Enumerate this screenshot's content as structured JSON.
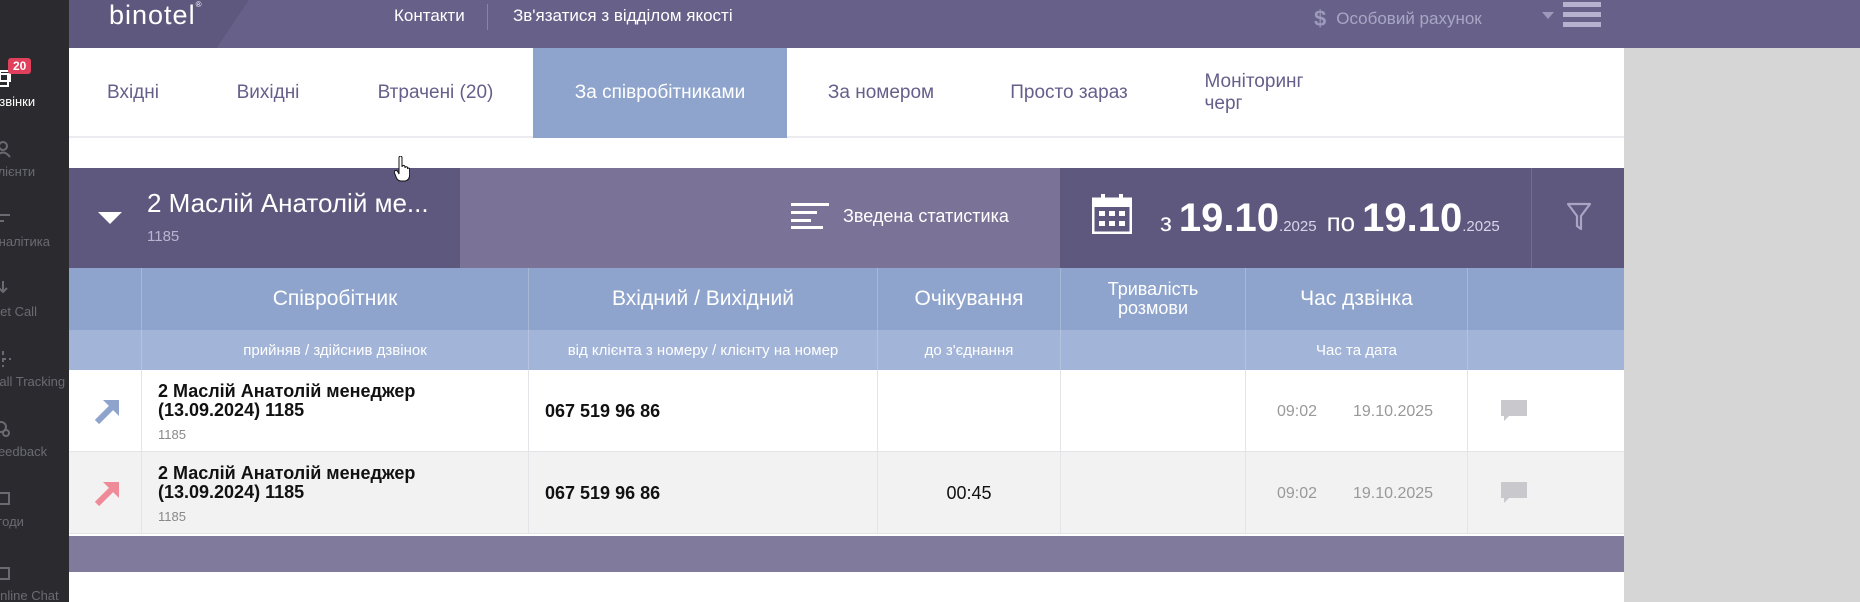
{
  "sidebar": {
    "badge": "20",
    "items": [
      {
        "label": "Дзвінки",
        "icon": "phone-calls-icon"
      },
      {
        "label": "Клієнти",
        "icon": "user-icon"
      },
      {
        "label": "Аналітика",
        "icon": "analytics-icon"
      },
      {
        "label": "Get Call",
        "icon": "get-call-icon"
      },
      {
        "label": "Call Tracking",
        "icon": "call-tracking-icon"
      },
      {
        "label": "Feedback",
        "icon": "feedback-icon"
      },
      {
        "label": "Угоди",
        "icon": "deals-icon"
      },
      {
        "label": "Online Chat",
        "icon": "chat-icon"
      }
    ]
  },
  "header": {
    "logo": "binotel",
    "links": [
      "Контакти",
      "Зв'язатися з відділом якості"
    ],
    "account": "Особовий рахунок",
    "account_icon": "dollar-icon"
  },
  "tabs": [
    {
      "label": "Вхідні",
      "active": false
    },
    {
      "label": "Вихідні",
      "active": false
    },
    {
      "label": "Втрачені (20)",
      "active": false
    },
    {
      "label": "За співробітниками",
      "active": true
    },
    {
      "label": "За номером",
      "active": false
    },
    {
      "label": "Просто зараз",
      "active": false
    },
    {
      "label": "Моніторинг",
      "label2": "черг",
      "active": false
    }
  ],
  "filter": {
    "employee_name": "2 Маслій Анатолій ме...",
    "employee_ext": "1185",
    "summary_label": "Зведена статистика",
    "date_from_word": "з",
    "date_from": "19.10",
    "date_from_year": ".2025",
    "date_to_word": "по",
    "date_to": "19.10",
    "date_to_year": ".2025"
  },
  "table": {
    "headers": [
      "Співробітник",
      "Вхідний / Вихідний",
      "Очікування",
      "Тривалість розмови",
      "Час дзвінка"
    ],
    "subheaders": [
      "прийняв / здійснив дзвінок",
      "від клієнта з номеру / клієнту на номер",
      "до з'єднання",
      "",
      "Час та дата"
    ],
    "rows": [
      {
        "direction": "incoming",
        "employee": "2 Маслій Анатолій менеджер (13.09.2024) 1185",
        "ext": "1185",
        "number": "067 519 96 86",
        "wait": "",
        "duration": "",
        "time": "09:02",
        "date": "19.10.2025"
      },
      {
        "direction": "outgoing",
        "employee": "2 Маслій Анатолій менеджер (13.09.2024) 1185",
        "ext": "1185",
        "number": "067 519 96 86",
        "wait": "00:45",
        "duration": "",
        "time": "09:02",
        "date": "19.10.2025"
      }
    ]
  },
  "colors": {
    "topbar": "#676189",
    "accent_tab": "#8fa4cc",
    "incoming_arrow": "#8fa4cc",
    "outgoing_arrow": "#ef8a98",
    "badge": "#e0405c"
  }
}
